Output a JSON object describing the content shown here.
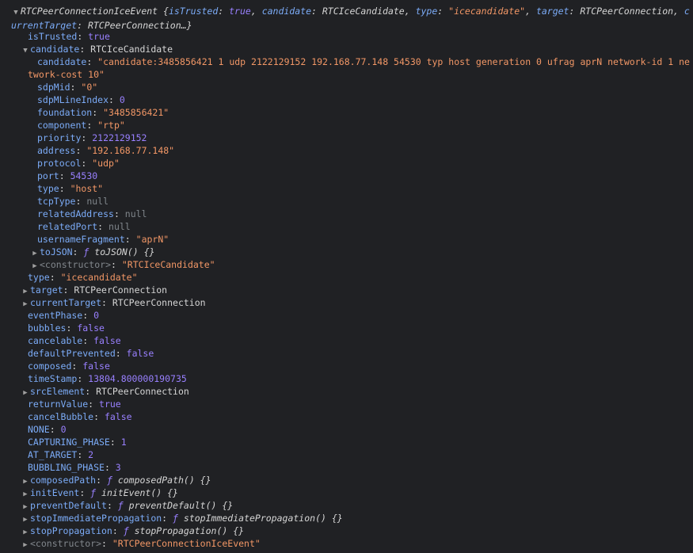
{
  "header": {
    "class_name": "RTCPeerConnectionIceEvent",
    "preview": [
      {
        "key": "isTrusted",
        "value": "true",
        "kind": "bool"
      },
      {
        "key": "candidate",
        "value": "RTCIceCandidate",
        "kind": "obj"
      },
      {
        "key": "type",
        "value": "\"icecandidate\"",
        "kind": "str"
      },
      {
        "key": "target",
        "value": "RTCPeerConnection",
        "kind": "obj"
      },
      {
        "key": "currentTarget",
        "value": "RTCPeerConnection…",
        "kind": "obj"
      }
    ],
    "open_brace": " {",
    "close_brace": "}"
  },
  "props": {
    "isTrusted": {
      "key": "isTrusted",
      "value": "true"
    },
    "candidate": {
      "key": "candidate",
      "value": "RTCIceCandidate"
    },
    "type": {
      "key": "type",
      "value": "\"icecandidate\""
    },
    "target": {
      "key": "target",
      "value": "RTCPeerConnection"
    },
    "currentTarget": {
      "key": "currentTarget",
      "value": "RTCPeerConnection"
    },
    "eventPhase": {
      "key": "eventPhase",
      "value": "0"
    },
    "bubbles": {
      "key": "bubbles",
      "value": "false"
    },
    "cancelable": {
      "key": "cancelable",
      "value": "false"
    },
    "defaultPrevented": {
      "key": "defaultPrevented",
      "value": "false"
    },
    "composed": {
      "key": "composed",
      "value": "false"
    },
    "timeStamp": {
      "key": "timeStamp",
      "value": "13804.800000190735"
    },
    "srcElement": {
      "key": "srcElement",
      "value": "RTCPeerConnection"
    },
    "returnValue": {
      "key": "returnValue",
      "value": "true"
    },
    "cancelBubble": {
      "key": "cancelBubble",
      "value": "false"
    },
    "NONE": {
      "key": "NONE",
      "value": "0"
    },
    "CAPTURING_PHASE": {
      "key": "CAPTURING_PHASE",
      "value": "1"
    },
    "AT_TARGET": {
      "key": "AT_TARGET",
      "value": "2"
    },
    "BUBBLING_PHASE": {
      "key": "BUBBLING_PHASE",
      "value": "3"
    },
    "composedPath": {
      "key": "composedPath",
      "f": "ƒ",
      "sig": "composedPath() {}"
    },
    "initEvent": {
      "key": "initEvent",
      "f": "ƒ",
      "sig": "initEvent() {}"
    },
    "preventDefault": {
      "key": "preventDefault",
      "f": "ƒ",
      "sig": "preventDefault() {}"
    },
    "stopImmediatePropagation": {
      "key": "stopImmediatePropagation",
      "f": "ƒ",
      "sig": "stopImmediatePropagation() {}"
    },
    "stopPropagation": {
      "key": "stopPropagation",
      "f": "ƒ",
      "sig": "stopPropagation() {}"
    },
    "constructor": {
      "key": "<constructor>",
      "value": "\"RTCPeerConnectionIceEvent\""
    }
  },
  "candidate": {
    "candidate": {
      "key": "candidate",
      "value": "\"candidate:3485856421 1 udp 2122129152 192.168.77.148 54530 typ host generation 0 ufrag aprN network-id 1 network-cost 10\""
    },
    "sdpMid": {
      "key": "sdpMid",
      "value": "\"0\""
    },
    "sdpMLineIndex": {
      "key": "sdpMLineIndex",
      "value": "0"
    },
    "foundation": {
      "key": "foundation",
      "value": "\"3485856421\""
    },
    "component": {
      "key": "component",
      "value": "\"rtp\""
    },
    "priority": {
      "key": "priority",
      "value": "2122129152"
    },
    "address": {
      "key": "address",
      "value": "\"192.168.77.148\""
    },
    "protocol": {
      "key": "protocol",
      "value": "\"udp\""
    },
    "port": {
      "key": "port",
      "value": "54530"
    },
    "type": {
      "key": "type",
      "value": "\"host\""
    },
    "tcpType": {
      "key": "tcpType",
      "value": "null"
    },
    "relatedAddress": {
      "key": "relatedAddress",
      "value": "null"
    },
    "relatedPort": {
      "key": "relatedPort",
      "value": "null"
    },
    "usernameFragment": {
      "key": "usernameFragment",
      "value": "\"aprN\""
    },
    "toJSON": {
      "key": "toJSON",
      "f": "ƒ",
      "sig": "toJSON() {}"
    },
    "constructor": {
      "key": "<constructor>",
      "value": "\"RTCIceCandidate\""
    }
  },
  "icons": {
    "expanded": "▼",
    "collapsed": "▶"
  },
  "colors": {
    "background": "#202124",
    "key": "#7cacf8",
    "string": "#f29766",
    "number": "#9980ff",
    "null": "#80868b",
    "text": "#d5d5d5"
  },
  "punct": {
    "colon": ": ",
    "comma": ", "
  }
}
